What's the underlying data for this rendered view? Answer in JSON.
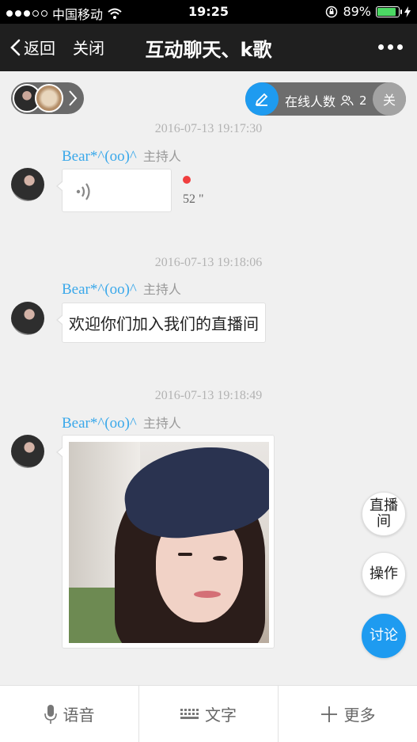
{
  "status": {
    "carrier": "中国移动",
    "time": "19:25",
    "battery_pct": "89%",
    "battery_level": 0.89
  },
  "nav": {
    "back_label": "返回",
    "close_label": "关闭",
    "title": "互动聊天、k歌"
  },
  "room": {
    "online_label": "在线人数",
    "online_count": "2",
    "close_label": "关"
  },
  "messages": [
    {
      "time": "2016-07-13 19:17:30",
      "sender": "Bear*^(oo)^",
      "role": "主持人",
      "type": "voice",
      "duration": "52 \""
    },
    {
      "time": "2016-07-13 19:18:06",
      "sender": "Bear*^(oo)^",
      "role": "主持人",
      "type": "text",
      "text": "欢迎你们加入我们的直播间"
    },
    {
      "time": "2016-07-13 19:18:49",
      "sender": "Bear*^(oo)^",
      "role": "主持人",
      "type": "image"
    }
  ],
  "side_buttons": {
    "live": "直播\n间",
    "operate": "操作",
    "discuss": "讨论"
  },
  "bottom_tabs": {
    "voice": "语音",
    "text": "文字",
    "more": "更多"
  },
  "colors": {
    "accent": "#1e9bf0",
    "sender_name": "#3aa8ea",
    "unread_dot": "#f03e3e",
    "battery": "#4cd964"
  }
}
